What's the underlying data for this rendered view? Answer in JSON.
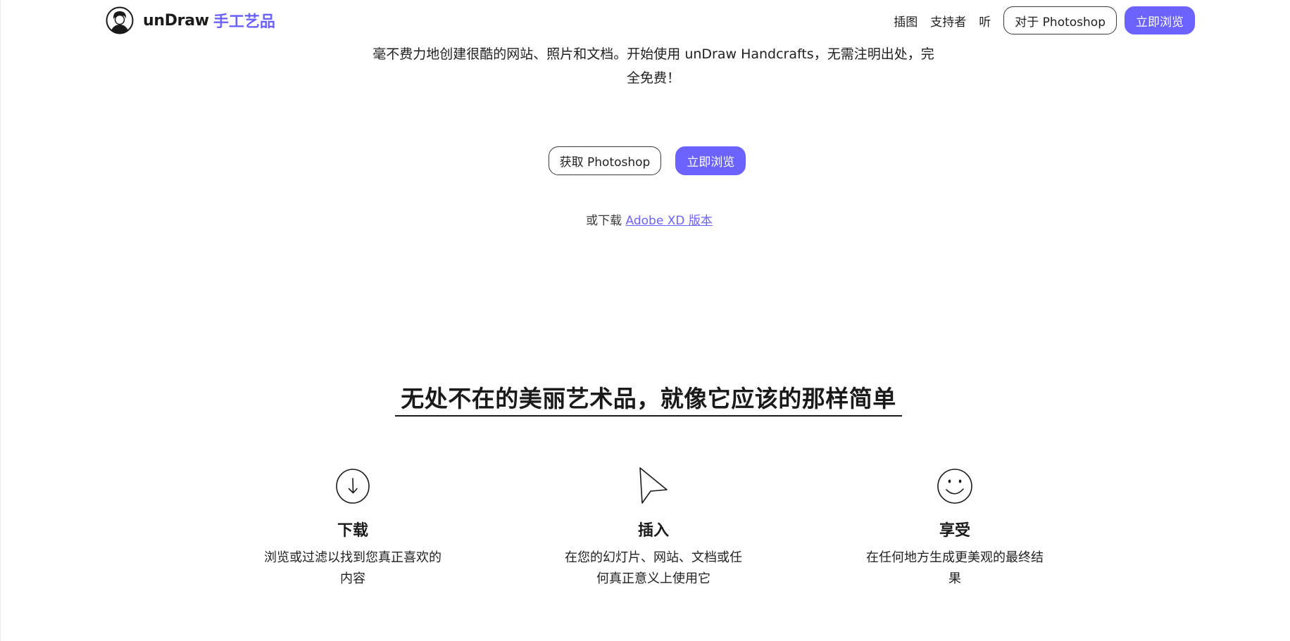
{
  "header": {
    "brand_name": "unDraw",
    "brand_sub": "手工艺品",
    "nav": [
      {
        "label": "插图"
      },
      {
        "label": "支持者"
      },
      {
        "label": "听"
      }
    ],
    "photoshop_button": "对于 Photoshop",
    "browse_button": "立即浏览"
  },
  "hero": {
    "description": "毫不费力地创建很酷的网站、照片和文档。开始使用 unDraw Handcrafts，无需注明出处，完全免费！",
    "get_photoshop_button": "获取 Photoshop",
    "browse_button": "立即浏览",
    "download_prefix": "或下载",
    "download_link": "Adobe XD 版本"
  },
  "features_section": {
    "title": "无处不在的美丽艺术品，就像它应该的那样简单",
    "items": [
      {
        "icon": "download-arrow-icon",
        "title": "下载",
        "text": "浏览或过滤以找到您真正喜欢的内容"
      },
      {
        "icon": "cursor-arrow-icon",
        "title": "插入",
        "text": "在您的幻灯片、网站、文档或任何真正意义上使用它"
      },
      {
        "icon": "smiley-icon",
        "title": "享受",
        "text": "在任何地方生成更美观的最终结果"
      }
    ]
  },
  "colors": {
    "accent": "#6c63ff",
    "text": "#1f1f1f",
    "background": "#ffffff"
  }
}
